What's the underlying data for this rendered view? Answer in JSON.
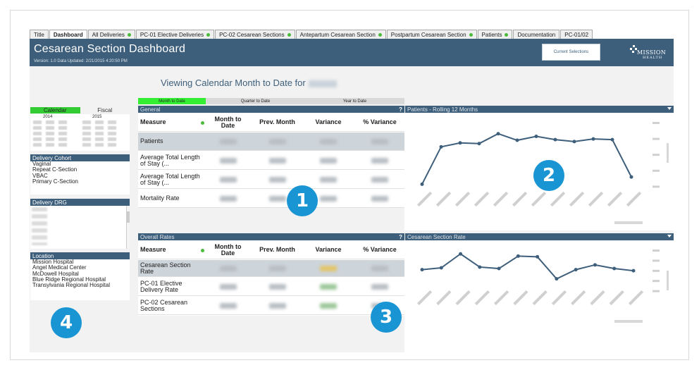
{
  "tabs": [
    {
      "label": "Title",
      "dot": false,
      "active": false
    },
    {
      "label": "Dashboard",
      "dot": false,
      "active": true
    },
    {
      "label": "All Deliveries",
      "dot": true,
      "active": false
    },
    {
      "label": "PC-01 Elective Deliveries",
      "dot": true,
      "active": false
    },
    {
      "label": "PC-02 Cesarean Sections",
      "dot": true,
      "active": false
    },
    {
      "label": "Antepartum Cesarean Section",
      "dot": true,
      "active": false
    },
    {
      "label": "Postpartum Cesarean Section",
      "dot": true,
      "active": false
    },
    {
      "label": "Patients",
      "dot": true,
      "active": false
    },
    {
      "label": "Documentation",
      "dot": false,
      "active": false
    },
    {
      "label": "PC-01/02",
      "dot": false,
      "active": false
    }
  ],
  "header": {
    "title": "Cesarean Section Dashboard",
    "version": "Version: 1.0   Data Updated: 2/21/2015 4:20:50 PM",
    "current_selections": "Current Selections",
    "logo_top": "MISSION",
    "logo_bottom": "HEALTH"
  },
  "viewing_label": "Viewing Calendar Month to Date for",
  "calendar": {
    "calendar_tab": "Calendar",
    "fiscal_tab": "Fiscal",
    "year_left": "2014",
    "year_right": "2015"
  },
  "delivery_cohort": {
    "heading": "Delivery Cohort",
    "items": [
      "Vaginal",
      "Repeat C-Section",
      "VBAC",
      "Primary C-Section"
    ]
  },
  "delivery_drg": {
    "heading": "Delivery DRG"
  },
  "location": {
    "heading": "Location",
    "items": [
      "Mission Hospital",
      "Angel Medical Center",
      "McDowell Hospital",
      "Blue Ridge Regional Hospital",
      "Transylvania Regional Hospital"
    ]
  },
  "period_tabs": [
    "Month to Date",
    "Quarter to Date",
    "Year to Date"
  ],
  "general": {
    "heading": "General",
    "help": "?",
    "columns": {
      "measure": "Measure",
      "mtd": "Month to Date",
      "prev": "Prev. Month",
      "variance": "Variance",
      "pct": "% Variance"
    },
    "rows": [
      "Patients",
      "Average Total Length of Stay (...",
      "Average Total Length of Stay (...",
      "Mortality Rate"
    ]
  },
  "overall": {
    "heading": "Overall Rates",
    "help": "?",
    "columns": {
      "measure": "Measure",
      "mtd": "Month to Date",
      "prev": "Prev. Month",
      "variance": "Variance",
      "pct": "% Variance"
    },
    "rows": [
      "Cesarean Section Rate",
      "PC-01 Elective Delivery Rate",
      "PC-02 Cesarean Sections"
    ]
  },
  "chart_patients": {
    "heading": "Patients - Rolling 12 Months"
  },
  "chart_cesarean": {
    "heading": "Cesarean Section Rate"
  },
  "badges": [
    "1",
    "2",
    "3",
    "4"
  ],
  "colors": {
    "header": "#3e5f7b",
    "accent_green": "#33cc33",
    "badge": "#1a95d4",
    "line": "#3e5f7b"
  },
  "chart_data": [
    {
      "type": "line",
      "title": "Patients - Rolling 12 Months",
      "x": [
        1,
        2,
        3,
        4,
        5,
        6,
        7,
        8,
        9,
        10,
        11,
        12,
        13
      ],
      "values": [
        5,
        62,
        68,
        67,
        82,
        72,
        78,
        73,
        70,
        74,
        73,
        16,
        0
      ],
      "ylim": [
        0,
        100
      ]
    },
    {
      "type": "line",
      "title": "Cesarean Section Rate",
      "x": [
        1,
        2,
        3,
        4,
        5,
        6,
        7,
        8,
        9,
        10,
        11,
        12,
        13
      ],
      "values": [
        45,
        50,
        88,
        52,
        48,
        82,
        80,
        20,
        45,
        58,
        48,
        42,
        0
      ],
      "ylim": [
        0,
        100
      ]
    }
  ]
}
